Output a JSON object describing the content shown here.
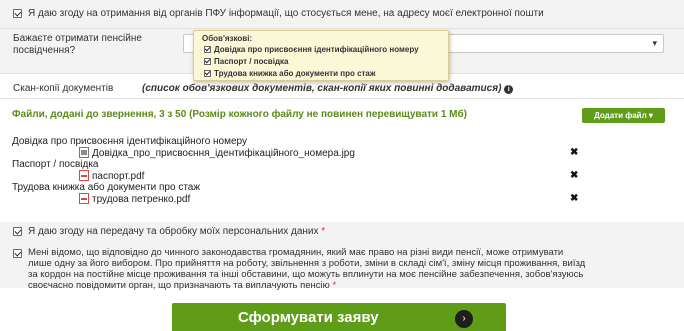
{
  "top_consent": {
    "checked": true,
    "label": "Я даю згоду на отримання від органів ПФУ інформації, що стосується мене, на адресу моєї електронної пошти"
  },
  "pension_receive": {
    "label_line1": "Бажаєте отримати пенсійне",
    "label_line2": "посвідчення?",
    "select_value": ""
  },
  "tooltip": {
    "title": "Обов'язкові:",
    "items": [
      "Довідка про присвоєння ідентифікаційного номеру",
      "Паспорт / посвідка",
      "Трудова книжка або документи про стаж"
    ]
  },
  "scans": {
    "title": "Скан-копії документів",
    "note": "(список обов'язкових документів, скан-копії яких повинні додаватися)"
  },
  "files": {
    "header": "Файли, додані до звернення, 3 з 50 (Розмір кожного файлу не повинен перевищувати 1 Мб)",
    "add_button": "Додати файл ▾",
    "documents": [
      {
        "title": "Довідка про присвоєння ідентифікаційного номеру",
        "file": "Довідка_про_присвоєння_ідентифікаційного_номера.jpg",
        "icon": "image-file-icon"
      },
      {
        "title": "Паспорт / посвідка",
        "file": "паспорт.pdf",
        "icon": "pdf-file-icon"
      },
      {
        "title": "Трудова книжка або документи про стаж",
        "file": "трудова петренко.pdf",
        "icon": "pdf-file-icon"
      }
    ],
    "delete_glyph": "✖"
  },
  "consent_data": {
    "checked": true,
    "label": "Я даю згоду на передачу та обробку моїх персональних даних",
    "required_mark": "*"
  },
  "consent_notice": {
    "checked": true,
    "line1": "Мені відомо, що відповідно до чинного законодавства громадянин, який має право на різні види пенсії, може отримувати",
    "line2": "лише одну за його вибором. Про прийняття на роботу, звільнення з роботи, зміни в складі сім'ї, зміну місця проживання, виїзд",
    "line3": "за кордон на постійне місце проживання та інші обставини, що можуть вплинути на моє пенсійне забезпечення, зобов'язуюсь",
    "line4": "своєчасно повідомити орган, що призначають та виплачують пенсію",
    "required_mark": "*"
  },
  "submit": {
    "label": "Сформувати заяву",
    "arrow": "›"
  },
  "colors": {
    "accent_green": "#5f9d19",
    "files_header_green": "#5b8b19",
    "required_red": "#d0302a",
    "tooltip_bg": "#fbf8d8"
  }
}
